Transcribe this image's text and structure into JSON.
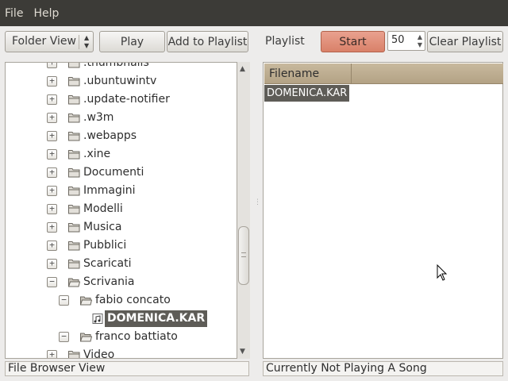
{
  "menu": {
    "file": "File",
    "help": "Help"
  },
  "toolbar": {
    "view_select": "Folder View",
    "play": "Play",
    "add_to_playlist": "Add to Playlist",
    "playlist_label": "Playlist",
    "start": "Start",
    "count_value": "50",
    "clear_playlist": "Clear Playlist"
  },
  "tree": {
    "rows": [
      {
        "label": ".thumbnails",
        "depth": 1,
        "expander": "+",
        "icon": "folder-closed-icon",
        "selected": false
      },
      {
        "label": ".ubuntuwintv",
        "depth": 1,
        "expander": "+",
        "icon": "folder-closed-icon",
        "selected": false
      },
      {
        "label": ".update-notifier",
        "depth": 1,
        "expander": "+",
        "icon": "folder-closed-icon",
        "selected": false
      },
      {
        "label": ".w3m",
        "depth": 1,
        "expander": "+",
        "icon": "folder-closed-icon",
        "selected": false
      },
      {
        "label": ".webapps",
        "depth": 1,
        "expander": "+",
        "icon": "folder-closed-icon",
        "selected": false
      },
      {
        "label": ".xine",
        "depth": 1,
        "expander": "+",
        "icon": "folder-closed-icon",
        "selected": false
      },
      {
        "label": "Documenti",
        "depth": 1,
        "expander": "+",
        "icon": "folder-closed-icon",
        "selected": false
      },
      {
        "label": "Immagini",
        "depth": 1,
        "expander": "+",
        "icon": "folder-closed-icon",
        "selected": false
      },
      {
        "label": "Modelli",
        "depth": 1,
        "expander": "+",
        "icon": "folder-closed-icon",
        "selected": false
      },
      {
        "label": "Musica",
        "depth": 1,
        "expander": "+",
        "icon": "folder-closed-icon",
        "selected": false
      },
      {
        "label": "Pubblici",
        "depth": 1,
        "expander": "+",
        "icon": "folder-closed-icon",
        "selected": false
      },
      {
        "label": "Scaricati",
        "depth": 1,
        "expander": "+",
        "icon": "folder-closed-icon",
        "selected": false
      },
      {
        "label": "Scrivania",
        "depth": 1,
        "expander": "−",
        "icon": "folder-open-icon",
        "selected": false
      },
      {
        "label": "fabio concato",
        "depth": 2,
        "expander": "−",
        "icon": "folder-open-icon",
        "selected": false
      },
      {
        "label": "DOMENICA.KAR",
        "depth": 3,
        "expander": "",
        "icon": "music-file-icon",
        "selected": true
      },
      {
        "label": "franco battiato",
        "depth": 2,
        "expander": "−",
        "icon": "folder-open-icon",
        "selected": false
      },
      {
        "label": "Video",
        "depth": 1,
        "expander": "+",
        "icon": "folder-closed-icon",
        "selected": false
      }
    ]
  },
  "playlist": {
    "column_header": "Filename",
    "items": [
      "DOMENICA.KAR"
    ]
  },
  "status": {
    "left": "File Browser View",
    "right": "Currently Not Playing A Song"
  },
  "colors": {
    "menubar": "#3c3b37",
    "selection": "#5e5c57",
    "start_button": "#d98169",
    "column_header": "#b3a285"
  }
}
